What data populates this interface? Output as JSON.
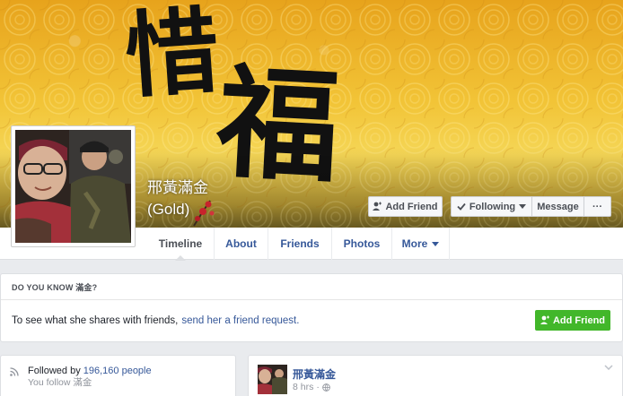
{
  "profile": {
    "name": "邢黃滿金",
    "nickname": "(Gold)",
    "cover_text": [
      "惜",
      "福"
    ]
  },
  "actions": {
    "add_friend": "Add Friend",
    "following": "Following",
    "message": "Message",
    "more": "···"
  },
  "nav": {
    "tabs": [
      "Timeline",
      "About",
      "Friends",
      "Photos",
      "More"
    ]
  },
  "know_card": {
    "heading": "DO YOU KNOW 滿金?",
    "body_text": "To see what she shares with friends,",
    "link_text": "send her a friend request.",
    "button": "Add Friend"
  },
  "follow_card": {
    "followed_by_label": "Followed by",
    "followers_count": "196,160 people",
    "you_follow": "You follow 滿金"
  },
  "post": {
    "author": "邢黃滿金",
    "time": "8 hrs",
    "separator": "·"
  },
  "colors": {
    "link_blue": "#365899",
    "green_button": "#42b72a",
    "cover_gold": "#f2c437"
  },
  "icons": [
    "add-friend-icon",
    "checkmark-icon",
    "caret-down-icon",
    "rss-icon",
    "globe-icon",
    "chevron-down-icon"
  ]
}
